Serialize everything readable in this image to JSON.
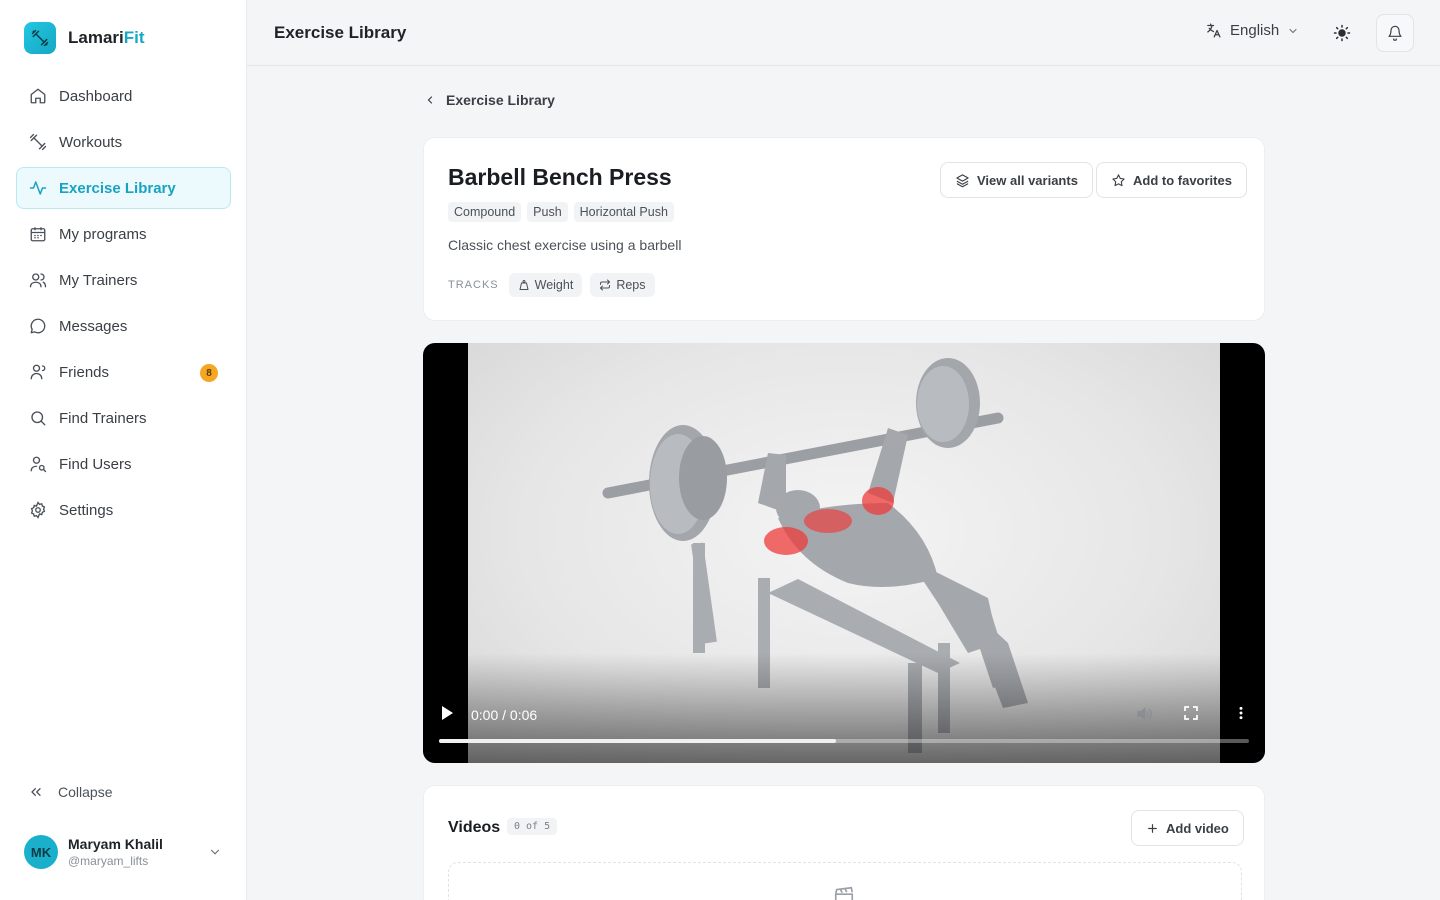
{
  "brand": {
    "name_main": "Lamari",
    "name_accent": "Fit",
    "accent_color": "#16a8c6"
  },
  "sidebar": {
    "items": [
      {
        "label": "Dashboard",
        "icon": "home-icon"
      },
      {
        "label": "Workouts",
        "icon": "dumbbell-icon"
      },
      {
        "label": "Exercise Library",
        "icon": "activity-icon",
        "active": true
      },
      {
        "label": "My programs",
        "icon": "calendar-icon"
      },
      {
        "label": "My Trainers",
        "icon": "users-icon"
      },
      {
        "label": "Messages",
        "icon": "message-icon"
      },
      {
        "label": "Friends",
        "icon": "user-group-icon",
        "badge": "8"
      },
      {
        "label": "Find Trainers",
        "icon": "search-icon"
      },
      {
        "label": "Find Users",
        "icon": "user-search-icon"
      },
      {
        "label": "Settings",
        "icon": "gear-icon"
      }
    ],
    "collapse_label": "Collapse"
  },
  "user": {
    "initials": "MK",
    "name": "Maryam Khalil",
    "handle": "@maryam_lifts"
  },
  "header": {
    "title": "Exercise Library",
    "language": "English"
  },
  "breadcrumb": {
    "label": "Exercise Library"
  },
  "exercise": {
    "title": "Barbell Bench Press",
    "tags": [
      "Compound",
      "Push",
      "Horizontal Push"
    ],
    "description": "Classic chest exercise using a barbell",
    "tracks_label": "TRACKS",
    "tracks": [
      "Weight",
      "Reps"
    ],
    "view_variants_label": "View all variants",
    "add_favorites_label": "Add to favorites"
  },
  "video": {
    "time": "0:00 / 0:06",
    "progress": 0.49
  },
  "videos": {
    "title": "Videos",
    "count": "0 of 5",
    "add_label": "Add video"
  }
}
